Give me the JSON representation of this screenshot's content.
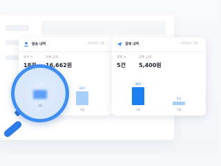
{
  "colors": {
    "accent": "#3f8df3",
    "bar_light": "#a9cdf9",
    "bar_strong": "#1a80f0",
    "card_bg": "#ffffff"
  },
  "card_left": {
    "icon": "person-icon",
    "title": "발송 내역",
    "period": "2026년 3월",
    "stat1_label": "횟수 수",
    "stat1_value": "18건",
    "stat2_label": "우편 금액",
    "stat2_value": "16,662원",
    "bars": [
      {
        "x_label": "1월",
        "value_label": "",
        "value": 6
      },
      {
        "x_label": "2월",
        "value_label": "18건",
        "value": 18
      }
    ]
  },
  "card_right": {
    "icon": "send-icon",
    "title": "결제 내역",
    "period": "2026년 3월",
    "stat1_label": "결제 수",
    "stat1_value": "5건",
    "stat2_label": "결제 금액",
    "stat2_value": "5,400원",
    "bars": [
      {
        "x_label": "1월",
        "value_label": "28건",
        "value": 28
      },
      {
        "x_label": "2월",
        "value_label": "5건",
        "value": 5
      }
    ]
  },
  "magnifier": {
    "bar_label": "6건",
    "x_label": "1월",
    "value": 6
  }
}
